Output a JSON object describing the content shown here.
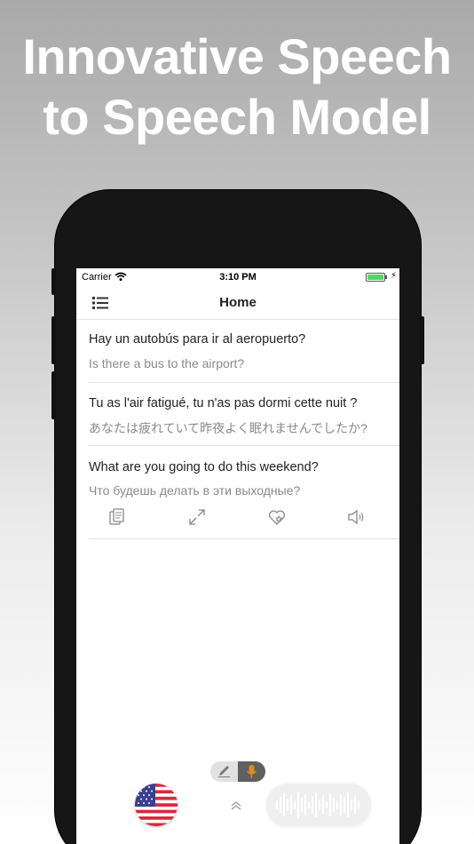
{
  "headline": {
    "line1": "Innovative Speech",
    "line2": "to Speech Model"
  },
  "status_bar": {
    "carrier": "Carrier",
    "time": "3:10 PM",
    "battery_level": 1.0
  },
  "nav": {
    "title": "Home",
    "menu_icon": "list-icon"
  },
  "translations": [
    {
      "source": "Hay un autobús para ir al aeropuerto?",
      "target": "Is there a bus to the airport?"
    },
    {
      "source": "Tu as l'air fatigué, tu n'as pas dormi cette nuit ?",
      "target": "あなたは疲れていて昨夜よく眠れませんでしたか?"
    },
    {
      "source": "What are you going to do this weekend?",
      "target": "Что будешь делать в эти выходные?"
    }
  ],
  "actions": [
    "copy-icon",
    "expand-icon",
    "favorite-icon",
    "speaker-icon"
  ],
  "bottom_bar": {
    "mode_toggle": {
      "left_icon": "pencil-icon",
      "right_icon": "microphone-icon",
      "selected": "microphone"
    },
    "language_flag": "us-flag-icon",
    "swap_icon": "double-chevron-up-icon",
    "record_icon": "waveform-icon"
  },
  "colors": {
    "accent": "#e38a1e",
    "battery": "#4cd964",
    "secondary_text": "#8a8a8a"
  }
}
